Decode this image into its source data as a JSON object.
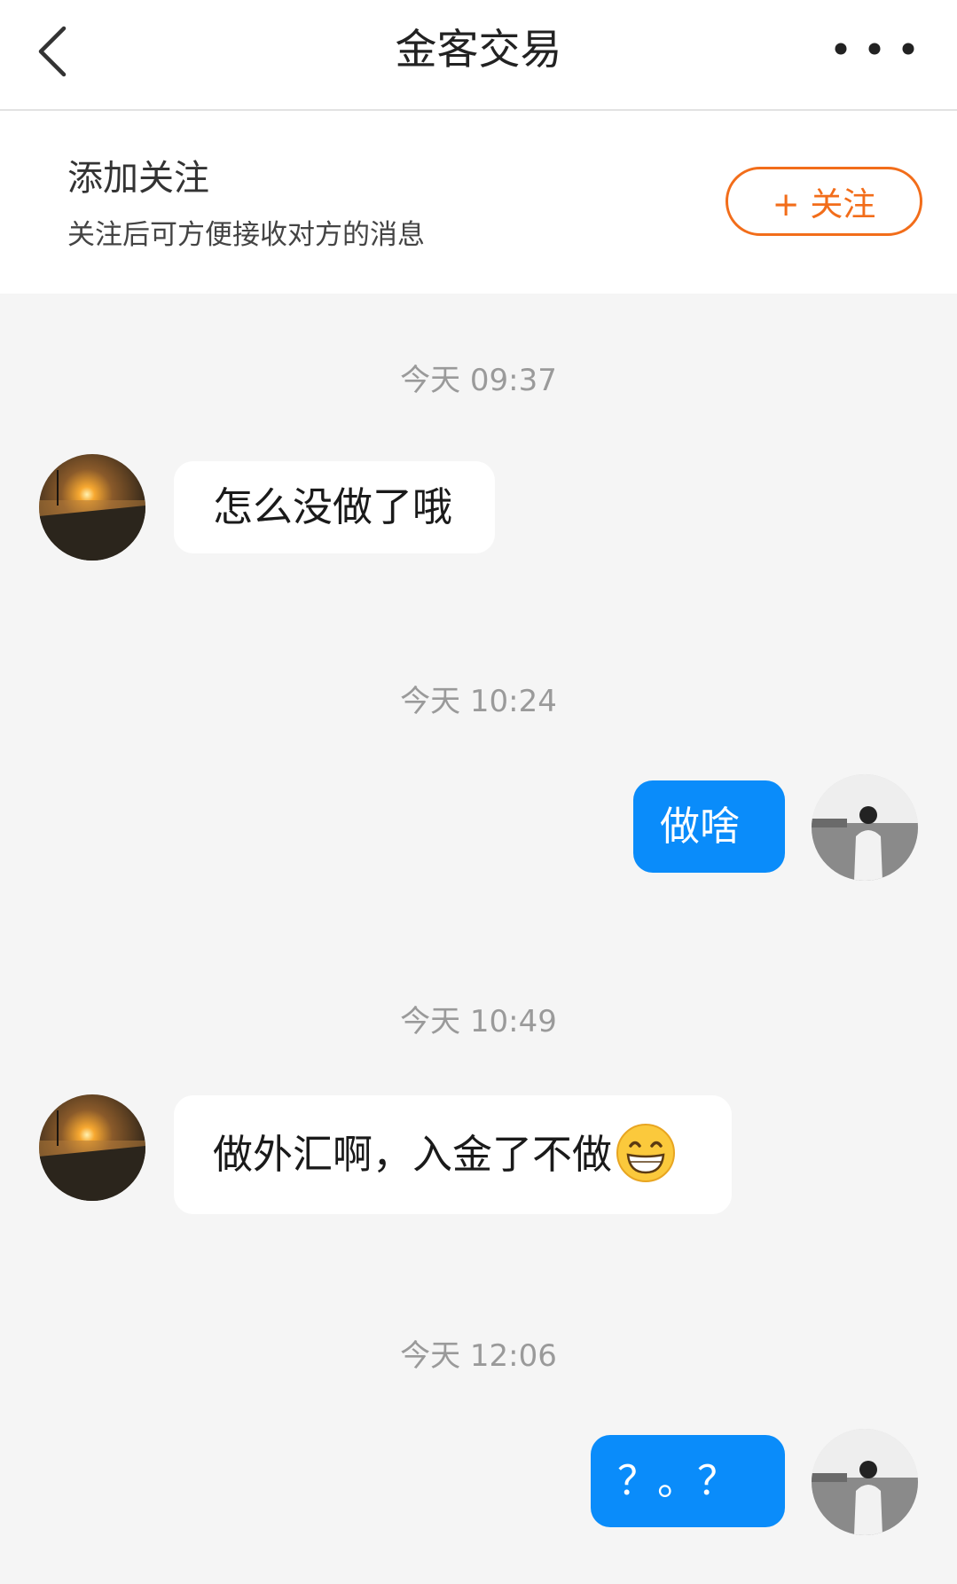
{
  "nav": {
    "title": "金客交易",
    "back_icon": "chevron-left-icon",
    "more_icon": "more-dots-icon"
  },
  "follow": {
    "title": "添加关注",
    "subtitle": "关注后可方便接收对方的消息",
    "button_label": "+ 关注",
    "accent_color": "#f26d1a"
  },
  "messages": [
    {
      "time": "今天 09:37",
      "from": "other",
      "text": "怎么没做了哦"
    },
    {
      "time": "今天 10:24",
      "from": "me",
      "text": "做啥"
    },
    {
      "time": "今天 10:49",
      "from": "other",
      "text": "做外汇啊，入金了不做",
      "emoji": "grinning-face-emoji"
    },
    {
      "time": "今天 12:06",
      "from": "me",
      "text": "？。？"
    }
  ],
  "colors": {
    "outgoing_bubble": "#0a8cfa",
    "incoming_bubble": "#ffffff",
    "background": "#f5f5f5"
  }
}
